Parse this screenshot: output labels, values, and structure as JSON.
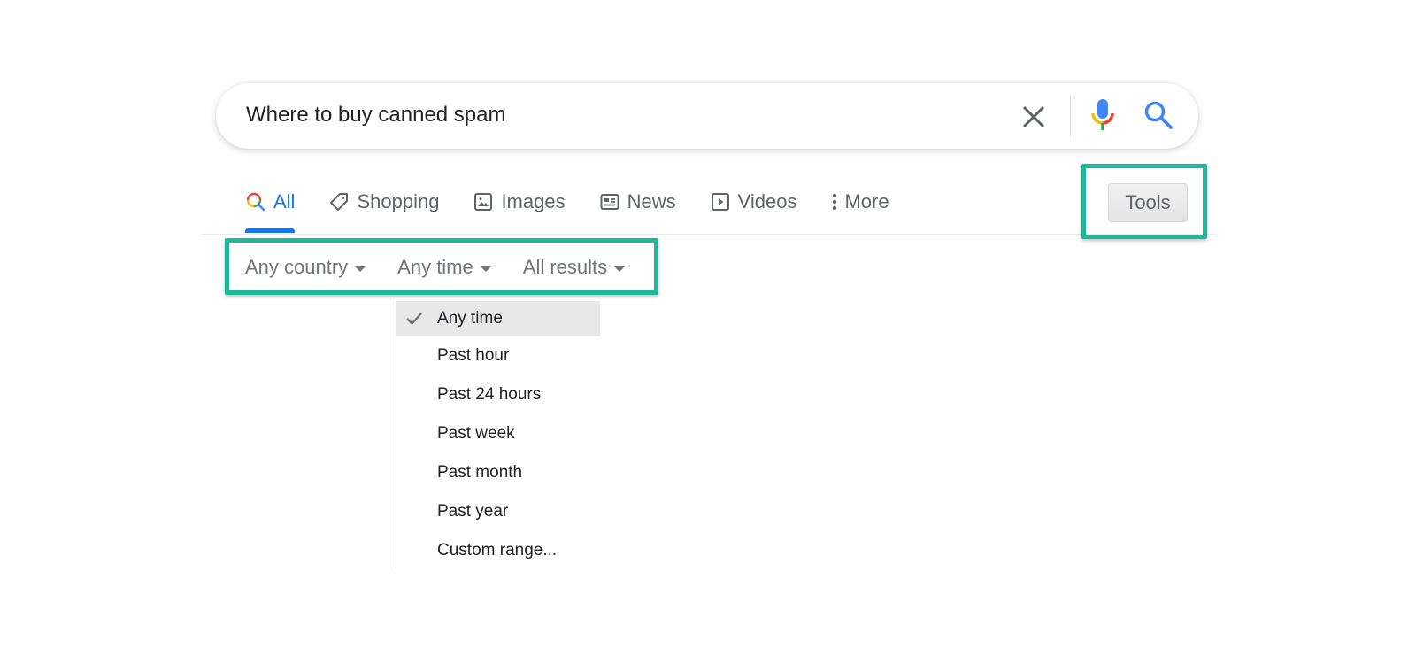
{
  "search": {
    "query": "Where to buy canned spam",
    "clear_icon": "close-icon",
    "voice_icon": "microphone-icon",
    "search_icon": "search-icon"
  },
  "tabs": [
    {
      "label": "All",
      "icon": "search-multicolor-icon",
      "active": true
    },
    {
      "label": "Shopping",
      "icon": "tag-icon",
      "active": false
    },
    {
      "label": "Images",
      "icon": "image-icon",
      "active": false
    },
    {
      "label": "News",
      "icon": "newspaper-icon",
      "active": false
    },
    {
      "label": "Videos",
      "icon": "play-icon",
      "active": false
    },
    {
      "label": "More",
      "icon": "more-vertical-icon",
      "active": false
    }
  ],
  "tools": {
    "label": "Tools"
  },
  "filters": [
    {
      "label": "Any country"
    },
    {
      "label": "Any time"
    },
    {
      "label": "All results"
    }
  ],
  "time_menu": {
    "selected": "Any time",
    "items": [
      {
        "label": "Any time",
        "selected": true
      },
      {
        "label": "Past hour",
        "selected": false
      },
      {
        "label": "Past 24 hours",
        "selected": false
      },
      {
        "label": "Past week",
        "selected": false
      },
      {
        "label": "Past month",
        "selected": false
      },
      {
        "label": "Past year",
        "selected": false
      },
      {
        "label": "Custom range...",
        "selected": false
      }
    ]
  },
  "colors": {
    "accent": "#1a73e8",
    "highlight": "#1db79a",
    "text_secondary": "#5f6368"
  }
}
